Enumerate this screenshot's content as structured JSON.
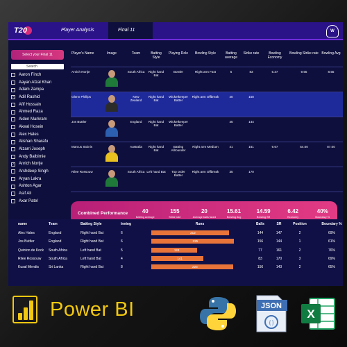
{
  "header": {
    "logo_text": "T20",
    "tabs": [
      "Player Analysis",
      "Final 11"
    ]
  },
  "sidebar": {
    "select_label": "Select your Final 11",
    "search_label": "Search",
    "players": [
      {
        "name": "Aaron Finch",
        "checked": false
      },
      {
        "name": "Aayan Afzal Khan",
        "checked": false
      },
      {
        "name": "Adam Zampa",
        "checked": false
      },
      {
        "name": "Adil Rashid",
        "checked": true
      },
      {
        "name": "Afif Hossain",
        "checked": false
      },
      {
        "name": "Ahmed Raza",
        "checked": false
      },
      {
        "name": "Aiden Markram",
        "checked": false
      },
      {
        "name": "Akeal Hosein",
        "checked": false
      },
      {
        "name": "Alex Hales",
        "checked": false
      },
      {
        "name": "Alishan Sharafu",
        "checked": false
      },
      {
        "name": "Alzarri Joseph",
        "checked": false
      },
      {
        "name": "Andy Balbirnie",
        "checked": false
      },
      {
        "name": "Anrich Nortje",
        "checked": true
      },
      {
        "name": "Arshdeep Singh",
        "checked": false
      },
      {
        "name": "Aryan Lakra",
        "checked": false
      },
      {
        "name": "Ashton Agar",
        "checked": false
      },
      {
        "name": "Asif Ali",
        "checked": false
      },
      {
        "name": "Axar Patel",
        "checked": false
      }
    ]
  },
  "player_table": {
    "columns": [
      "Player's Name",
      "Image",
      "Team",
      "Batting Style",
      "Playing Role",
      "Bowling Style",
      "Batting average",
      "Strike rate",
      "Bowling Economy",
      "Bowling Strike rate",
      "Bowling Avg"
    ],
    "rows": [
      {
        "name": "Anrich Nortje",
        "team": "South Africa",
        "batting_style": "Right hand Bat",
        "role": "Bowler",
        "bowling_style": "Right arm Fast",
        "bat_avg": "5",
        "sr": "83",
        "economy": "5.37",
        "bowl_sr": "9.55",
        "bowl_avg": "8.55",
        "shirt": "#1f7a3a"
      },
      {
        "name": "Glenn Phillips",
        "team": "New Zealand",
        "batting_style": "Right hand Bat",
        "role": "Wicketkeeper Batter",
        "bowling_style": "Right arm Offbreak",
        "bat_avg": "40",
        "sr": "158",
        "economy": "",
        "bowl_sr": "",
        "bowl_avg": "",
        "shirt": "#2b2b2b"
      },
      {
        "name": "Jos Buttler",
        "team": "England",
        "batting_style": "Right hand Bat",
        "role": "Wicketkeeper Batter",
        "bowling_style": "",
        "bat_avg": "45",
        "sr": "144",
        "economy": "",
        "bowl_sr": "",
        "bowl_avg": "",
        "shirt": "#2c5fb0"
      },
      {
        "name": "Marcus Stoinis",
        "team": "Australia",
        "batting_style": "Right hand Bat",
        "role": "Batting Allrounder",
        "bowling_style": "Right arm Medium",
        "bat_avg": "41",
        "sr": "161",
        "economy": "9.67",
        "bowl_sr": "54.00",
        "bowl_avg": "87.00",
        "shirt": "#e8c020"
      },
      {
        "name": "Rilee Rossouw",
        "team": "South Africa",
        "batting_style": "Left hand Bat",
        "role": "Top order Batter",
        "bowling_style": "Right arm Offbreak",
        "bat_avg": "35",
        "sr": "170",
        "economy": "",
        "bowl_sr": "",
        "bowl_avg": "",
        "shirt": "#1f7a3a"
      }
    ]
  },
  "combined": {
    "title": "Combined Performance",
    "kpis": [
      {
        "value": "40",
        "label": "Batting average"
      },
      {
        "value": "155",
        "label": "Strike rate"
      },
      {
        "value": "20",
        "label": "Average balls faced"
      },
      {
        "value": "15.61",
        "label": "Bowling Avg"
      },
      {
        "value": "14.59",
        "label": "Bowling SR"
      },
      {
        "value": "6.42",
        "label": "Economy"
      },
      {
        "value": "40%",
        "label": "Boundary %"
      }
    ]
  },
  "batting_table": {
    "columns": [
      "name",
      "Team",
      "Batting Style",
      "Inning",
      "Runs",
      "Balls",
      "SR",
      "Position",
      "Boundary %"
    ],
    "max_runs": 272,
    "rows": [
      {
        "name": "Alex Hales",
        "team": "England",
        "style": "Right hand Bat",
        "inning": "6",
        "runs": 212,
        "balls": "144",
        "sr": "147",
        "position": "2",
        "boundary": "69%"
      },
      {
        "name": "Jos Buttler",
        "team": "England",
        "style": "Right hand Bat",
        "inning": "6",
        "runs": 225,
        "balls": "156",
        "sr": "144",
        "position": "1",
        "boundary": "61%"
      },
      {
        "name": "Quinton de Kock",
        "team": "South Africa",
        "style": "Left hand Bat",
        "inning": "5",
        "runs": 124,
        "balls": "77",
        "sr": "161",
        "position": "2",
        "boundary": "76%"
      },
      {
        "name": "Rilee Rossouw",
        "team": "South Africa",
        "style": "Left hand Bat",
        "inning": "4",
        "runs": 141,
        "balls": "83",
        "sr": "170",
        "position": "3",
        "boundary": "69%"
      },
      {
        "name": "Kusal Mendis",
        "team": "Sri Lanka",
        "style": "Right hand Bat",
        "inning": "8",
        "runs": 223,
        "balls": "156",
        "sr": "143",
        "position": "2",
        "boundary": "65%"
      }
    ]
  },
  "footer": {
    "brand": "Power BI",
    "json_label": "JSON",
    "excel_label": "X"
  },
  "colors": {
    "accent_pink": "#d7387f",
    "bar_orange": "#e8743a",
    "powerbi_yellow": "#f2c811",
    "header_purple": "#2a1388"
  }
}
